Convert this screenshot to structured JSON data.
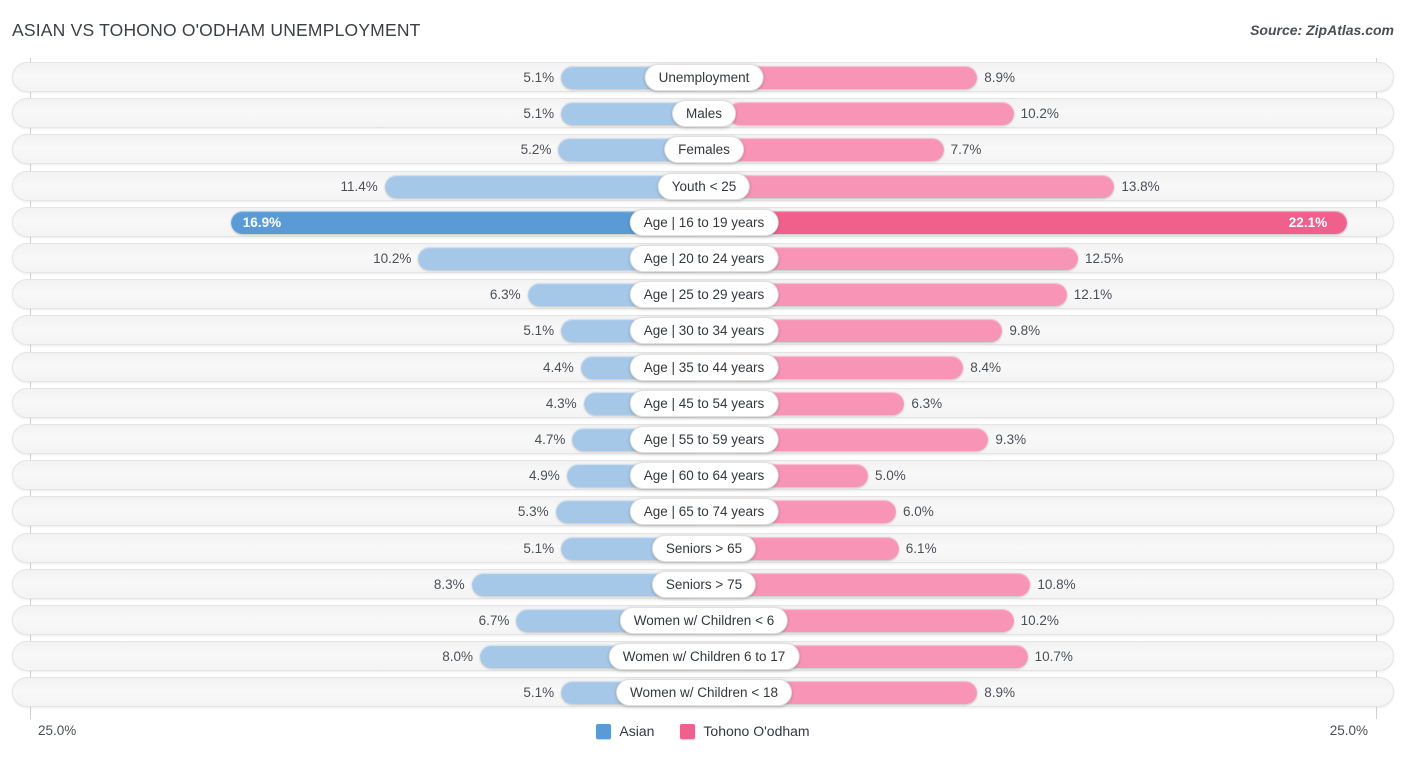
{
  "header": {
    "title": "ASIAN VS TOHONO O'ODHAM UNEMPLOYMENT",
    "source": "Source: ZipAtlas.com"
  },
  "legend": {
    "items": [
      {
        "label": "Asian",
        "color": "#5b9bd5"
      },
      {
        "label": "Tohono O'odham",
        "color": "#f0608d"
      }
    ]
  },
  "axis": {
    "left_tick": "25.0%",
    "right_tick": "25.0%"
  },
  "colors": {
    "left_normal": "#a6c8e8",
    "right_normal": "#f894b6",
    "left_highlight": "#5b9bd5",
    "right_highlight": "#f0608d",
    "track": "#f4f4f4",
    "text": "#4b5057"
  },
  "chart_data": {
    "type": "bar",
    "orientation": "horizontal-diverging",
    "title": "ASIAN VS TOHONO O'ODHAM UNEMPLOYMENT",
    "xlabel": "",
    "ylabel": "",
    "xlim": [
      25.0,
      25.0
    ],
    "axis_max": 25.0,
    "grid": false,
    "legend_position": "bottom-center",
    "categories": [
      "Unemployment",
      "Males",
      "Females",
      "Youth < 25",
      "Age | 16 to 19 years",
      "Age | 20 to 24 years",
      "Age | 25 to 29 years",
      "Age | 30 to 34 years",
      "Age | 35 to 44 years",
      "Age | 45 to 54 years",
      "Age | 55 to 59 years",
      "Age | 60 to 64 years",
      "Age | 65 to 74 years",
      "Seniors > 65",
      "Seniors > 75",
      "Women w/ Children < 6",
      "Women w/ Children 6 to 17",
      "Women w/ Children < 18"
    ],
    "series": [
      {
        "name": "Asian",
        "color": "#a6c8e8",
        "values": [
          5.1,
          5.1,
          5.2,
          11.4,
          16.9,
          10.2,
          6.3,
          5.1,
          4.4,
          4.3,
          4.7,
          4.9,
          5.3,
          5.1,
          8.3,
          6.7,
          8.0,
          5.1
        ],
        "labels": [
          "5.1%",
          "5.1%",
          "5.2%",
          "11.4%",
          "16.9%",
          "10.2%",
          "6.3%",
          "5.1%",
          "4.4%",
          "4.3%",
          "4.7%",
          "4.9%",
          "5.3%",
          "5.1%",
          "8.3%",
          "6.7%",
          "8.0%",
          "5.1%"
        ]
      },
      {
        "name": "Tohono O'odham",
        "color": "#f894b6",
        "values": [
          8.9,
          10.2,
          7.7,
          13.8,
          22.1,
          12.5,
          12.1,
          9.8,
          8.4,
          6.3,
          9.3,
          5.0,
          6.0,
          6.1,
          10.8,
          10.2,
          10.7,
          8.9
        ],
        "labels": [
          "8.9%",
          "10.2%",
          "7.7%",
          "13.8%",
          "22.1%",
          "12.5%",
          "12.1%",
          "9.8%",
          "8.4%",
          "6.3%",
          "9.3%",
          "5.0%",
          "6.0%",
          "6.1%",
          "10.8%",
          "10.2%",
          "10.7%",
          "8.9%"
        ]
      }
    ],
    "highlight_index": 4
  }
}
